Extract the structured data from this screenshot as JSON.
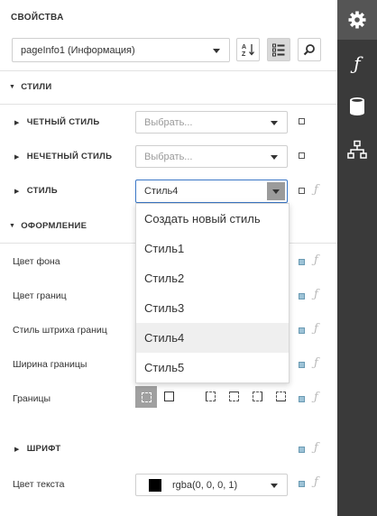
{
  "panel": {
    "title": "СВОЙСТВА",
    "object_selector": "pageInfo1 (Информация)"
  },
  "groups": {
    "styles": "СТИЛИ",
    "appearance": "ОФОРМЛЕНИЕ"
  },
  "styles": {
    "even_label": "ЧЕТНЫЙ СТИЛЬ",
    "even_placeholder": "Выбрать...",
    "odd_label": "НЕЧЕТНЫЙ СТИЛЬ",
    "odd_placeholder": "Выбрать...",
    "style_label": "СТИЛЬ",
    "style_value": "Стиль4"
  },
  "style_dropdown": {
    "options": [
      "Создать новый стиль",
      "Стиль1",
      "Стиль2",
      "Стиль3",
      "Стиль4",
      "Стиль5"
    ],
    "highlighted": "Стиль4"
  },
  "appearance": {
    "background_color": "Цвет фона",
    "border_color": "Цвет границ",
    "border_dash_style": "Стиль штриха границ",
    "border_width": "Ширина границы",
    "borders": "Границы",
    "font": "ШРИФТ",
    "text_color": "Цвет текста",
    "text_color_value": "rgba(0, 0, 0, 1)"
  },
  "colors": {
    "sidebar": "#3a3a3a",
    "accent": "#3b77c6",
    "checkbox_blue": "#9dc3d7"
  },
  "icons": [
    "gear-icon",
    "function-icon",
    "database-icon",
    "hierarchy-icon",
    "sort-az-icon",
    "categorized-icon",
    "search-icon"
  ]
}
